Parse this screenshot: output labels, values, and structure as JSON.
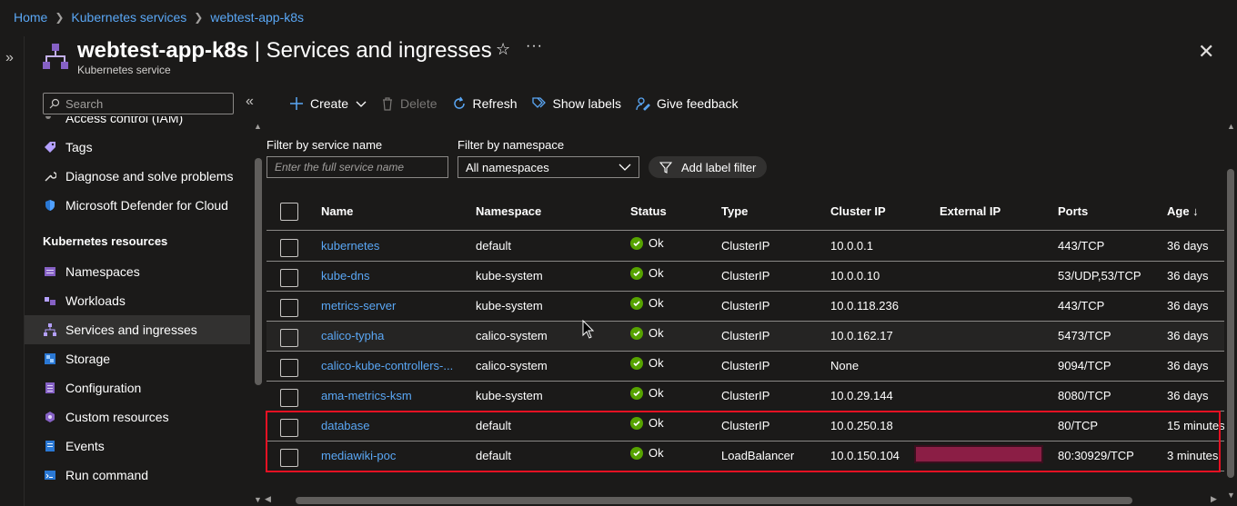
{
  "breadcrumb": [
    "Home",
    "Kubernetes services",
    "webtest-app-k8s"
  ],
  "header": {
    "resource_name": "webtest-app-k8s",
    "separator": " | ",
    "page_name": "Services and ingresses",
    "subtitle": "Kubernetes service"
  },
  "search": {
    "placeholder": "Search"
  },
  "sidebar": {
    "items_top": [
      {
        "label": "Access control (IAM)",
        "icon": "access-control-icon"
      },
      {
        "label": "Tags",
        "icon": "tag-icon"
      },
      {
        "label": "Diagnose and solve problems",
        "icon": "wrench-icon"
      },
      {
        "label": "Microsoft Defender for Cloud",
        "icon": "shield-icon"
      }
    ],
    "section_title": "Kubernetes resources",
    "items": [
      {
        "label": "Namespaces",
        "icon": "namespaces-icon"
      },
      {
        "label": "Workloads",
        "icon": "workloads-icon"
      },
      {
        "label": "Services and ingresses",
        "icon": "services-icon",
        "active": true
      },
      {
        "label": "Storage",
        "icon": "storage-icon"
      },
      {
        "label": "Configuration",
        "icon": "configuration-icon"
      },
      {
        "label": "Custom resources",
        "icon": "custom-resources-icon"
      },
      {
        "label": "Events",
        "icon": "events-icon"
      },
      {
        "label": "Run command",
        "icon": "run-command-icon"
      }
    ]
  },
  "toolbar": {
    "create": "Create",
    "delete": "Delete",
    "refresh": "Refresh",
    "show_labels": "Show labels",
    "give_feedback": "Give feedback"
  },
  "filters": {
    "service_label": "Filter by service name",
    "service_placeholder": "Enter the full service name",
    "namespace_label": "Filter by namespace",
    "namespace_value": "All namespaces",
    "add_label_filter": "Add label filter"
  },
  "table": {
    "headers": [
      "Name",
      "Namespace",
      "Status",
      "Type",
      "Cluster IP",
      "External IP",
      "Ports",
      "Age ↓"
    ],
    "rows": [
      {
        "name": "kubernetes",
        "namespace": "default",
        "status": "Ok",
        "type": "ClusterIP",
        "cluster_ip": "10.0.0.1",
        "external_ip": "",
        "ports": "443/TCP",
        "age": "36 days"
      },
      {
        "name": "kube-dns",
        "namespace": "kube-system",
        "status": "Ok",
        "type": "ClusterIP",
        "cluster_ip": "10.0.0.10",
        "external_ip": "",
        "ports": "53/UDP,53/TCP",
        "age": "36 days"
      },
      {
        "name": "metrics-server",
        "namespace": "kube-system",
        "status": "Ok",
        "type": "ClusterIP",
        "cluster_ip": "10.0.118.236",
        "external_ip": "",
        "ports": "443/TCP",
        "age": "36 days"
      },
      {
        "name": "calico-typha",
        "namespace": "calico-system",
        "status": "Ok",
        "type": "ClusterIP",
        "cluster_ip": "10.0.162.17",
        "external_ip": "",
        "ports": "5473/TCP",
        "age": "36 days"
      },
      {
        "name": "calico-kube-controllers-...",
        "namespace": "calico-system",
        "status": "Ok",
        "type": "ClusterIP",
        "cluster_ip": "None",
        "external_ip": "",
        "ports": "9094/TCP",
        "age": "36 days"
      },
      {
        "name": "ama-metrics-ksm",
        "namespace": "kube-system",
        "status": "Ok",
        "type": "ClusterIP",
        "cluster_ip": "10.0.29.144",
        "external_ip": "",
        "ports": "8080/TCP",
        "age": "36 days"
      },
      {
        "name": "database",
        "namespace": "default",
        "status": "Ok",
        "type": "ClusterIP",
        "cluster_ip": "10.0.250.18",
        "external_ip": "",
        "ports": "80/TCP",
        "age": "15 minutes"
      },
      {
        "name": "mediawiki-poc",
        "namespace": "default",
        "status": "Ok",
        "type": "LoadBalancer",
        "cluster_ip": "10.0.150.104",
        "external_ip": "",
        "external_ip_redacted": true,
        "ports": "80:30929/TCP",
        "age": "3 minutes"
      }
    ]
  },
  "colors": {
    "accent_link": "#5aa7f5",
    "status_ok": "#57a300",
    "highlight_border": "#e81123",
    "redaction": "#8b1e45"
  }
}
